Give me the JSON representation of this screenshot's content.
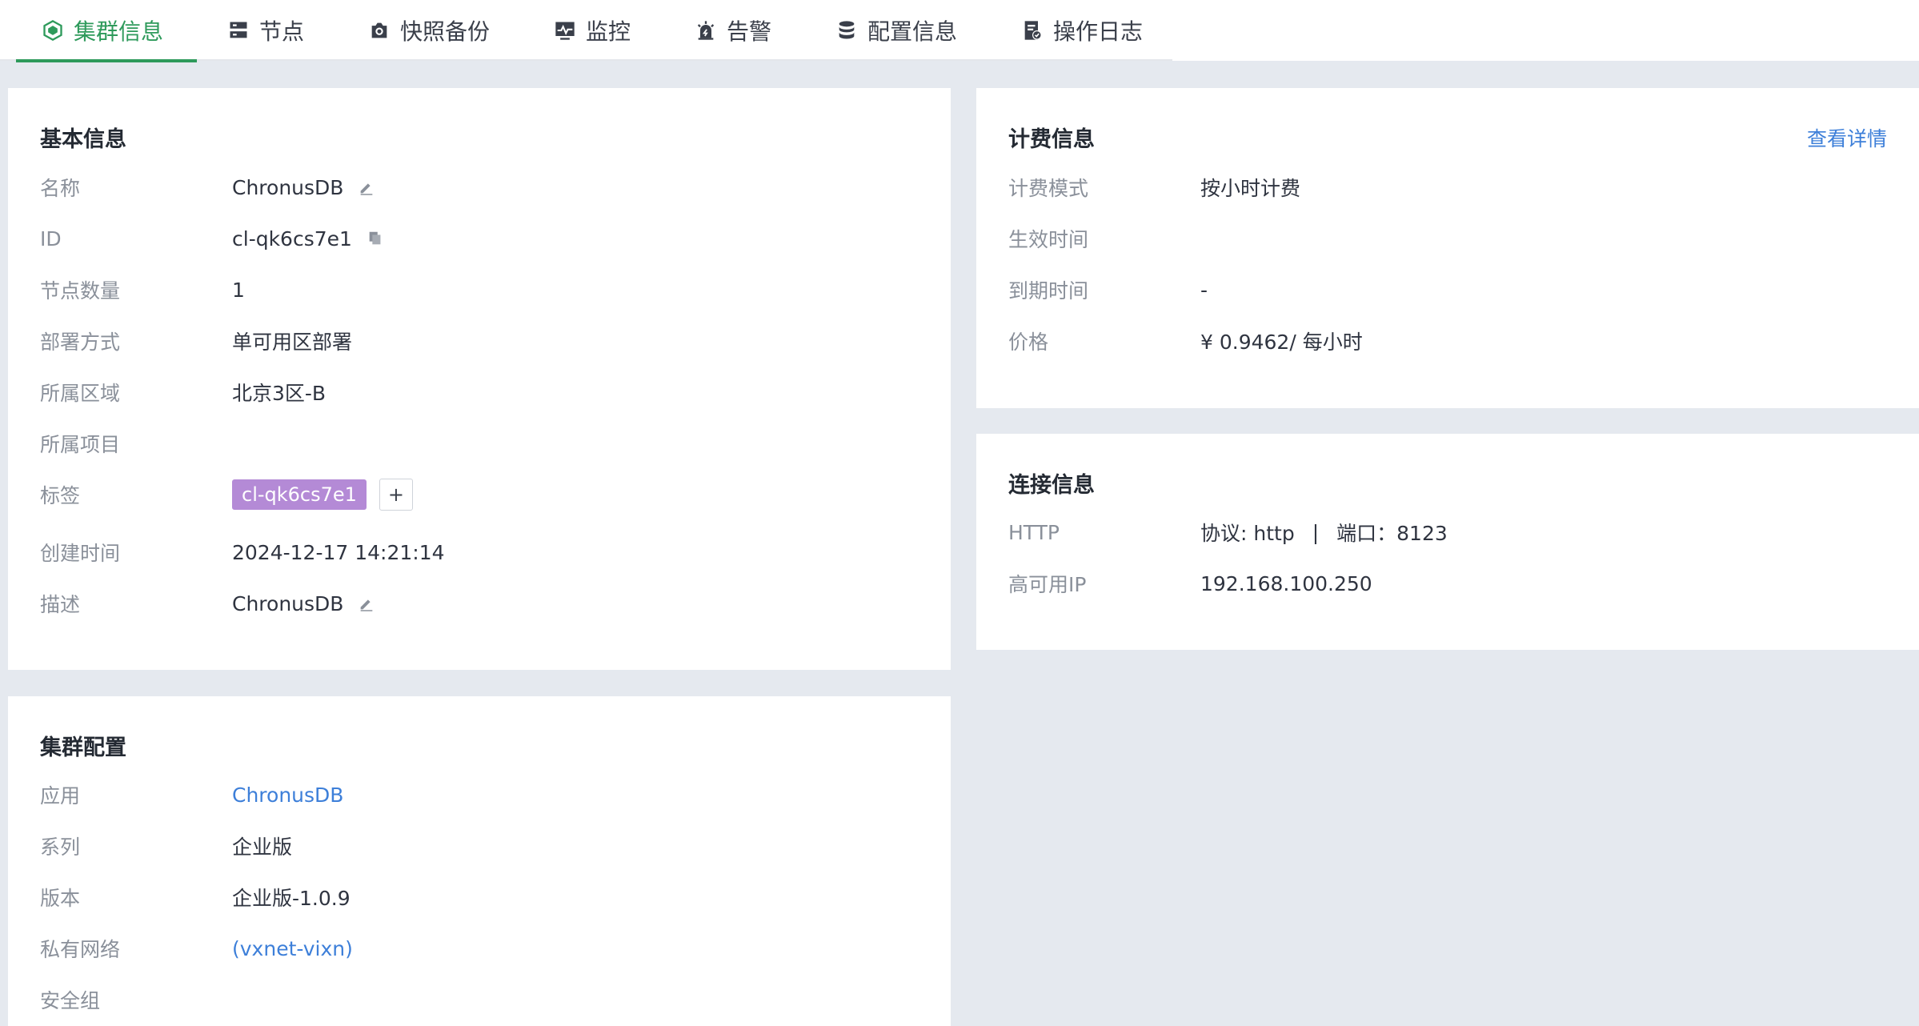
{
  "tabs": [
    {
      "label": "集群信息",
      "icon": "cluster-icon",
      "active": true
    },
    {
      "label": "节点",
      "icon": "server-icon"
    },
    {
      "label": "快照备份",
      "icon": "camera-icon"
    },
    {
      "label": "监控",
      "icon": "monitor-icon"
    },
    {
      "label": "告警",
      "icon": "alarm-icon"
    },
    {
      "label": "配置信息",
      "icon": "database-icon"
    },
    {
      "label": "操作日志",
      "icon": "log-icon"
    }
  ],
  "basic": {
    "title": "基本信息",
    "name_label": "名称",
    "name_value": "ChronusDB",
    "id_label": "ID",
    "id_value": "cl-qk6cs7e1",
    "nodes_label": "节点数量",
    "nodes_value": "1",
    "deploy_label": "部署方式",
    "deploy_value": "单可用区部署",
    "region_label": "所属区域",
    "region_value": "北京3区-B",
    "project_label": "所属项目",
    "project_value": "",
    "tags_label": "标签",
    "tag_value": "cl-qk6cs7e1",
    "tag_add": "+",
    "created_label": "创建时间",
    "created_value": "2024-12-17 14:21:14",
    "desc_label": "描述",
    "desc_value": "ChronusDB"
  },
  "cluster_config": {
    "title": "集群配置",
    "app_label": "应用",
    "app_value": "ChronusDB",
    "series_label": "系列",
    "series_value": "企业版",
    "version_label": "版本",
    "version_value": "企业版-1.0.9",
    "vpc_label": "私有网络",
    "vpc_value": "(vxnet-vixn)",
    "sg_label": "安全组",
    "sg_value": ""
  },
  "billing": {
    "title": "计费信息",
    "detail_link": "查看详情",
    "mode_label": "计费模式",
    "mode_value": "按小时计费",
    "effective_label": "生效时间",
    "effective_value": "",
    "expire_label": "到期时间",
    "expire_value": "-",
    "price_label": "价格",
    "price_value": "¥ 0.9462/ 每小时"
  },
  "connection": {
    "title": "连接信息",
    "http_label": "HTTP",
    "http_protocol": "协议: http",
    "http_sep": "|",
    "http_port": "端口：8123",
    "ha_label": "高可用IP",
    "ha_value": "192.168.100.250"
  },
  "colors": {
    "accent": "#2e9a5b",
    "link": "#3d7fd9",
    "tag": "#b48ad6",
    "background": "#e5e9ef"
  }
}
